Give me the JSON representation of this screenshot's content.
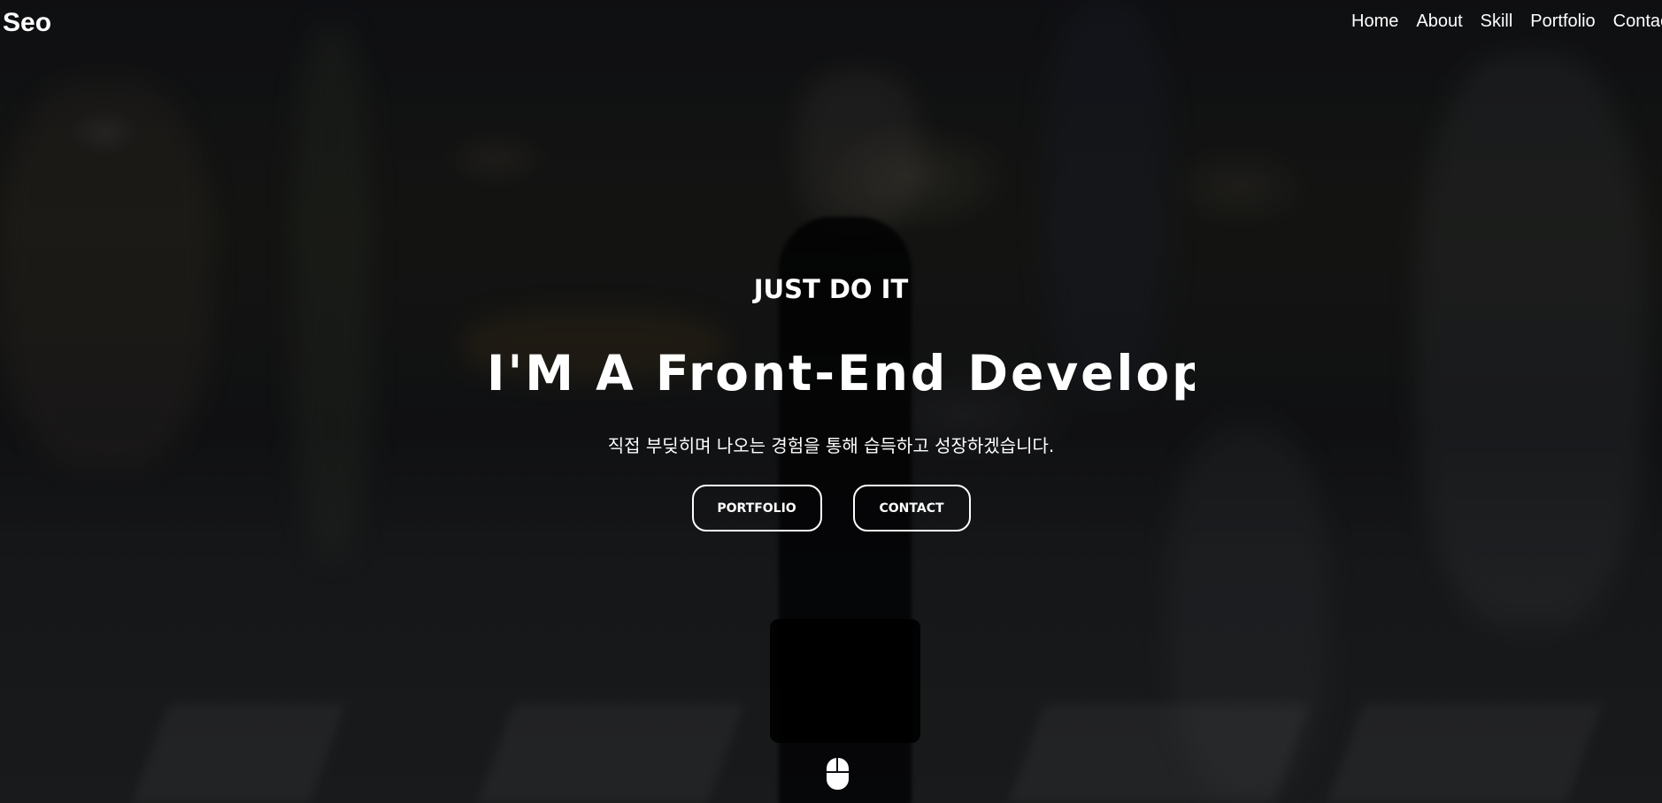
{
  "nav": {
    "logo": "Seo",
    "items": [
      {
        "label": "Home"
      },
      {
        "label": "About"
      },
      {
        "label": "Skill"
      },
      {
        "label": "Portfolio"
      },
      {
        "label": "Contact"
      }
    ]
  },
  "hero": {
    "tagline": "JUST DO IT",
    "headline": "I'M A Front-End Developer",
    "subtitle": "직접 부딪히며 나오는 경험을 통해 습득하고 성장하겠습니다.",
    "buttons": {
      "portfolio": "PORTFOLIO",
      "contact": "CONTACT"
    },
    "scroll_icon": "mouse-icon"
  },
  "colors": {
    "text": "#ffffff",
    "overlay": "#000000"
  }
}
